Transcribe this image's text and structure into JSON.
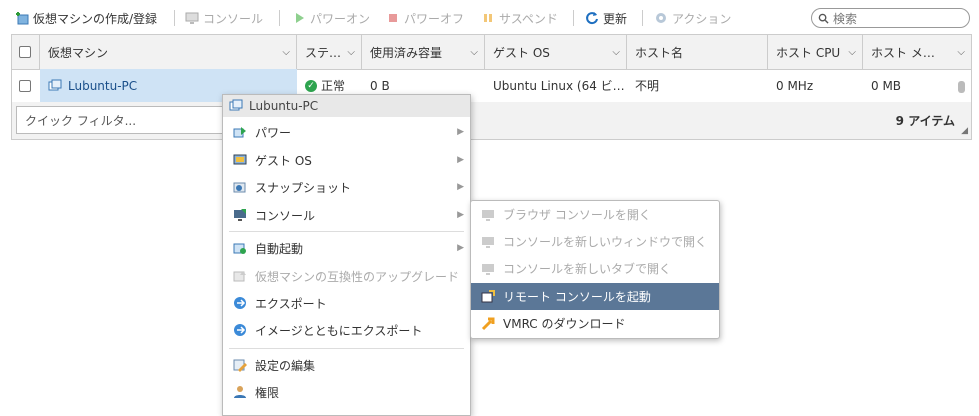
{
  "toolbar": {
    "create_vm": "仮想マシンの作成/登録",
    "console": "コンソール",
    "power_on": "パワーオン",
    "power_off": "パワーオフ",
    "suspend": "サスペンド",
    "refresh": "更新",
    "actions": "アクション",
    "search_placeholder": "検索"
  },
  "grid": {
    "columns": [
      "仮想マシン",
      "ステ…",
      "使用済み容量",
      "ゲスト OS",
      "ホスト名",
      "ホスト CPU",
      "ホスト メ…"
    ],
    "rows": [
      {
        "name": "Lubuntu-PC",
        "status": "正常",
        "used": "0 B",
        "guest_os": "Ubuntu Linux (64 ビ…",
        "host_name": "不明",
        "host_cpu": "0 MHz",
        "host_mem": "0 MB"
      }
    ],
    "quick_filter_placeholder": "クイック フィルタ...",
    "item_count": "9 アイテム"
  },
  "context_menu": {
    "title": "Lubuntu-PC",
    "items": [
      {
        "label": "パワー",
        "submenu": true
      },
      {
        "label": "ゲスト OS",
        "submenu": true
      },
      {
        "label": "スナップショット",
        "submenu": true
      },
      {
        "label": "コンソール",
        "submenu": true
      },
      {
        "label": "自動起動",
        "submenu": true
      },
      {
        "label": "仮想マシンの互換性のアップグレード",
        "disabled": true
      },
      {
        "label": "エクスポート"
      },
      {
        "label": "イメージとともにエクスポート"
      },
      {
        "label": "設定の編集"
      },
      {
        "label": "権限"
      }
    ]
  },
  "console_submenu": {
    "items": [
      {
        "label": "ブラウザ コンソールを開く",
        "disabled": true
      },
      {
        "label": "コンソールを新しいウィンドウで開く",
        "disabled": true
      },
      {
        "label": "コンソールを新しいタブで開く",
        "disabled": true
      },
      {
        "label": "リモート コンソールを起動",
        "active": true
      },
      {
        "label": "VMRC のダウンロード"
      }
    ]
  },
  "colors": {
    "highlight": "#5b7797",
    "selected_row": "#cfe3f5",
    "header_bg": "#f2f2f2",
    "status_ok": "#2ea44f",
    "refresh_blue": "#1e6fc0"
  }
}
